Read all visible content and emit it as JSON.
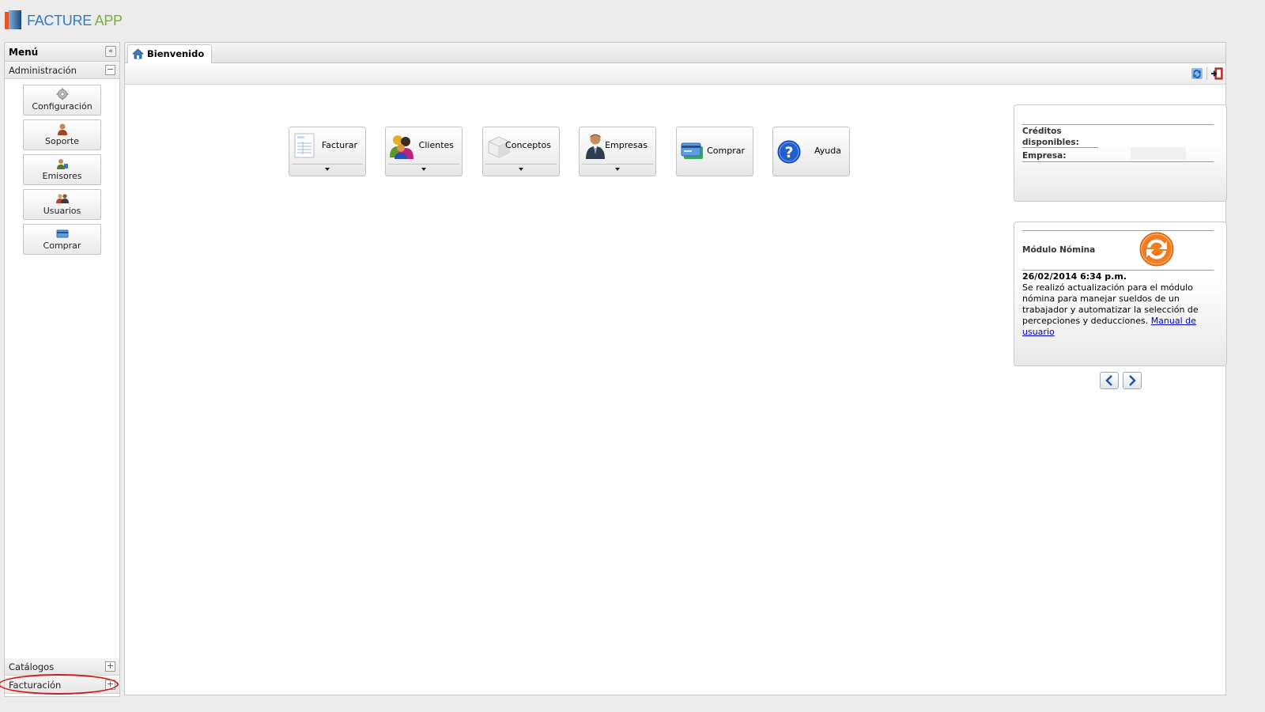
{
  "app": {
    "logo_facture": "FACTURE",
    "logo_app": " APP"
  },
  "sidebar": {
    "title": "Menú",
    "collapse_icon": "double-chevron-left-icon",
    "sections": [
      {
        "label": "Administración",
        "state": "expanded",
        "toggle": "−"
      },
      {
        "label": "Catálogos",
        "state": "collapsed",
        "toggle": "+"
      },
      {
        "label": "Facturación",
        "state": "collapsed",
        "toggle": "+"
      }
    ],
    "admin_items": [
      {
        "label": "Configuración",
        "icon": "gear-icon"
      },
      {
        "label": "Soporte",
        "icon": "support-person-icon"
      },
      {
        "label": "Emisores",
        "icon": "emitter-icon"
      },
      {
        "label": "Usuarios",
        "icon": "users-icon"
      },
      {
        "label": "Comprar",
        "icon": "credit-card-icon"
      }
    ]
  },
  "tabs": [
    {
      "label": "Bienvenido",
      "icon": "home-icon",
      "active": true
    }
  ],
  "toolbar": {
    "refresh_icon": "refresh-icon",
    "logout_icon": "logout-icon"
  },
  "main_buttons": [
    {
      "label": "Facturar",
      "icon": "invoice-icon",
      "has_dropdown": true
    },
    {
      "label": "Clientes",
      "icon": "clients-icon",
      "has_dropdown": true
    },
    {
      "label": "Conceptos",
      "icon": "box-icon",
      "has_dropdown": true
    },
    {
      "label": "Empresas",
      "icon": "business-person-icon",
      "has_dropdown": true
    },
    {
      "label": "Comprar",
      "icon": "credit-card-icon",
      "has_dropdown": false
    },
    {
      "label": "Ayuda",
      "icon": "help-icon",
      "has_dropdown": false
    }
  ],
  "credits_widget": {
    "credits_label_line1": "Créditos",
    "credits_label_line2": "disponibles:",
    "credits_value": "",
    "company_label": "Empresa:",
    "company_value": ""
  },
  "news_widget": {
    "title": "Módulo Nómina",
    "date": "26/02/2014 6:34 p.m.",
    "body": "Se realizó actualización para el módulo nómina para manejar sueldos de un trabajador y automatizar la selección de percepciones y deducciones. ",
    "link_text": "Manual de usuario"
  },
  "colors": {
    "logo_blue": "#2f7cc4",
    "logo_green": "#7ab134",
    "highlight": "#d11a1a",
    "sync_orange": "#f07d1f",
    "help_blue": "#1f5fcf"
  }
}
